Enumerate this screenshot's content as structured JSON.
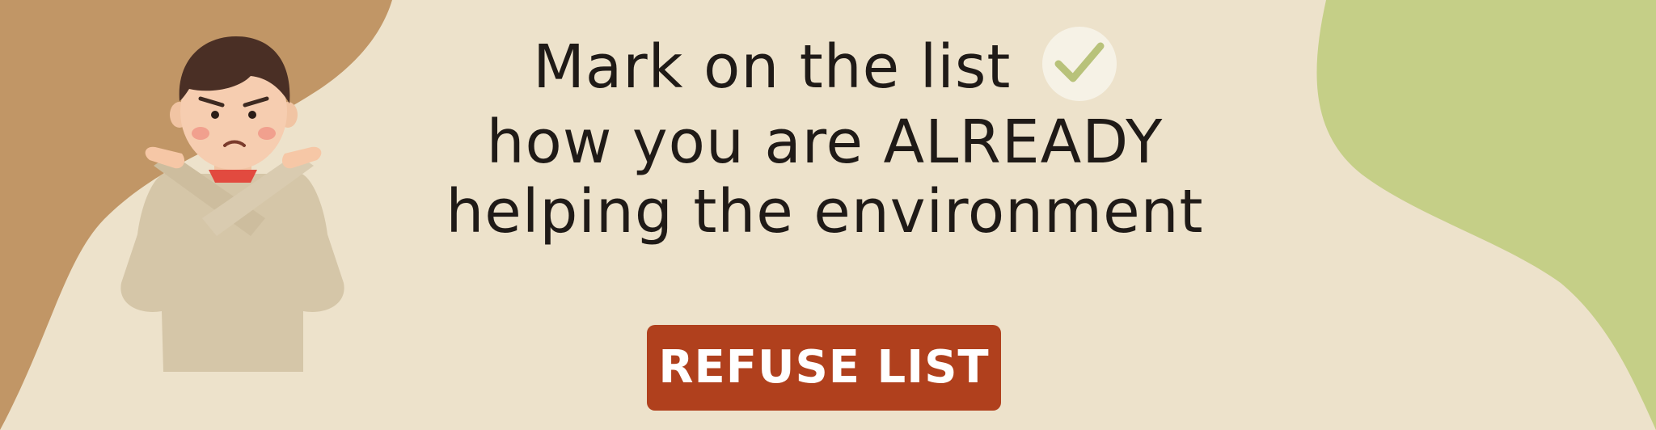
{
  "banner": {
    "headline_line1": "Mark on the list",
    "headline_line2": "how you are ALREADY",
    "headline_line3": "helping the environment",
    "button_label": "REFUSE LIST"
  },
  "colors": {
    "background": "#ede2cb",
    "left_blob": "#c19666",
    "right_blob": "#c5cf87",
    "button": "#b0401d",
    "check_mark": "#b8c27a"
  },
  "icons": [
    "check-icon",
    "person-crossing-arms-illustration"
  ]
}
